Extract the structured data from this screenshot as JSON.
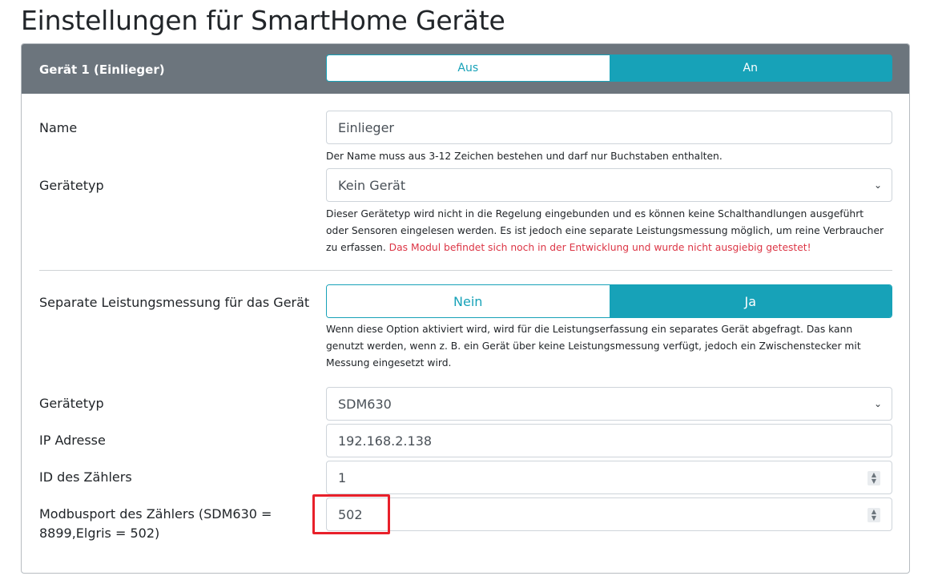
{
  "page": {
    "title": "Einstellungen für SmartHome Geräte"
  },
  "device": {
    "header_title": "Gerät 1 (Einlieger)",
    "state_toggle": {
      "off_label": "Aus",
      "on_label": "An",
      "selected": "An"
    },
    "name_label": "Name",
    "name_value": "Einlieger",
    "name_help": "Der Name muss aus 3-12 Zeichen bestehen und darf nur Buchstaben enthalten.",
    "type_label": "Gerätetyp",
    "type_value": "Kein Gerät",
    "type_help": "Dieser Gerätetyp wird nicht in die Regelung eingebunden und es können keine Schalthandlungen ausgeführt oder Sensoren eingelesen werden. Es ist jedoch eine separate Leistungsmessung möglich, um reine Verbraucher zu erfassen.",
    "type_warning": "Das Modul befindet sich noch in der Entwicklung und wurde nicht ausgiebig getestet!"
  },
  "measurement": {
    "label": "Separate Leistungsmessung für das Gerät",
    "toggle": {
      "off_label": "Nein",
      "on_label": "Ja",
      "selected": "Ja"
    },
    "help": "Wenn diese Option aktiviert wird, wird für die Leistungserfassung ein separates Gerät abgefragt. Das kann genutzt werden, wenn z. B. ein Gerät über keine Leistungsmessung verfügt, jedoch ein Zwischenstecker mit Messung eingesetzt wird.",
    "type_label": "Gerätetyp",
    "type_value": "SDM630",
    "ip_label": "IP Adresse",
    "ip_value": "192.168.2.138",
    "id_label": "ID des Zählers",
    "id_value": "1",
    "port_label": "Modbusport des Zählers (SDM630 = 8899,Elgris = 502)",
    "port_value": "502"
  },
  "colors": {
    "accent": "#17a2b8",
    "header_bg": "#6c757d",
    "warning": "#dc3545",
    "highlight": "#e8202a"
  }
}
